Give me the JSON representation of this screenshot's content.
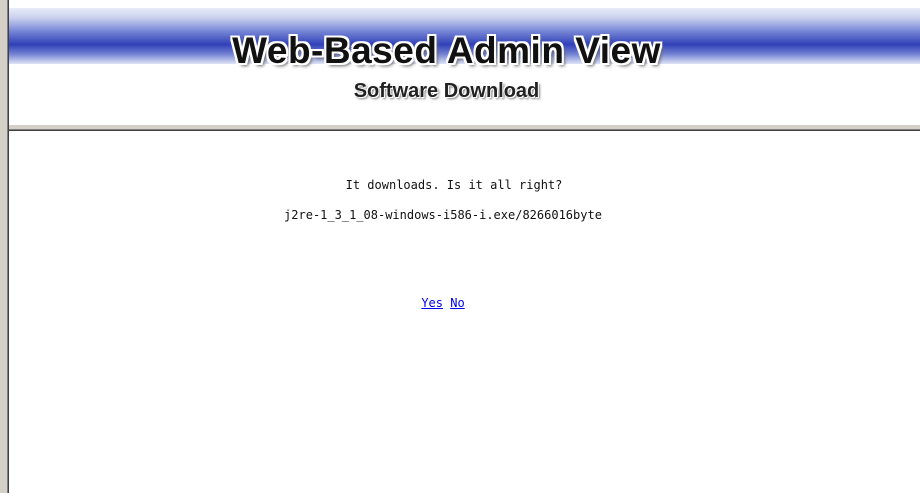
{
  "header": {
    "title": "Web-Based Admin View",
    "subtitle": "Software Download"
  },
  "content": {
    "message": "It downloads. Is it all right?",
    "file_info": "j2re-1_3_1_08-windows-i586-i.exe/8266016byte",
    "yes_label": "Yes",
    "no_label": "No"
  },
  "colors": {
    "link": "#0000ee",
    "banner_dark": "#3141b8",
    "background": "#ffffff"
  }
}
